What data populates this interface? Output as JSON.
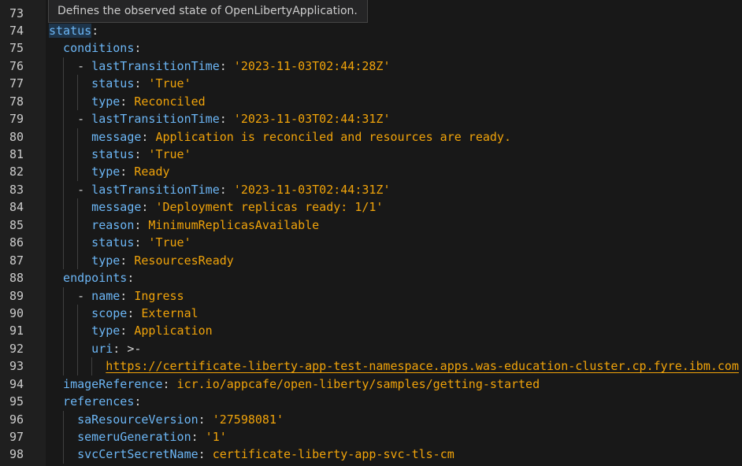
{
  "tooltip": {
    "text": "Defines the observed state of OpenLibertyApplication."
  },
  "colors": {
    "key": "#6cb6f5",
    "value": "#f0a30a",
    "background": "#181818"
  },
  "lines": [
    {
      "n": "73",
      "indent": 0,
      "tokens": []
    },
    {
      "n": "74",
      "indent": 0,
      "tokens": [
        {
          "t": "status",
          "c": "k hl"
        },
        {
          "t": ":",
          "c": "p"
        }
      ]
    },
    {
      "n": "75",
      "indent": 2,
      "tokens": [
        {
          "t": "conditions",
          "c": "k"
        },
        {
          "t": ":",
          "c": "p"
        }
      ]
    },
    {
      "n": "76",
      "indent": 4,
      "tokens": [
        {
          "t": "- ",
          "c": "p"
        },
        {
          "t": "lastTransitionTime",
          "c": "k"
        },
        {
          "t": ": ",
          "c": "p"
        },
        {
          "t": "'2023-11-03T02:44:28Z'",
          "c": "v"
        }
      ]
    },
    {
      "n": "77",
      "indent": 6,
      "tokens": [
        {
          "t": "status",
          "c": "k"
        },
        {
          "t": ": ",
          "c": "p"
        },
        {
          "t": "'True'",
          "c": "v"
        }
      ]
    },
    {
      "n": "78",
      "indent": 6,
      "tokens": [
        {
          "t": "type",
          "c": "k"
        },
        {
          "t": ": ",
          "c": "p"
        },
        {
          "t": "Reconciled",
          "c": "v"
        }
      ]
    },
    {
      "n": "79",
      "indent": 4,
      "tokens": [
        {
          "t": "- ",
          "c": "p"
        },
        {
          "t": "lastTransitionTime",
          "c": "k"
        },
        {
          "t": ": ",
          "c": "p"
        },
        {
          "t": "'2023-11-03T02:44:31Z'",
          "c": "v"
        }
      ]
    },
    {
      "n": "80",
      "indent": 6,
      "tokens": [
        {
          "t": "message",
          "c": "k"
        },
        {
          "t": ": ",
          "c": "p"
        },
        {
          "t": "Application is reconciled and resources are ready.",
          "c": "v"
        }
      ]
    },
    {
      "n": "81",
      "indent": 6,
      "tokens": [
        {
          "t": "status",
          "c": "k"
        },
        {
          "t": ": ",
          "c": "p"
        },
        {
          "t": "'True'",
          "c": "v"
        }
      ]
    },
    {
      "n": "82",
      "indent": 6,
      "tokens": [
        {
          "t": "type",
          "c": "k"
        },
        {
          "t": ": ",
          "c": "p"
        },
        {
          "t": "Ready",
          "c": "v"
        }
      ]
    },
    {
      "n": "83",
      "indent": 4,
      "tokens": [
        {
          "t": "- ",
          "c": "p"
        },
        {
          "t": "lastTransitionTime",
          "c": "k"
        },
        {
          "t": ": ",
          "c": "p"
        },
        {
          "t": "'2023-11-03T02:44:31Z'",
          "c": "v"
        }
      ]
    },
    {
      "n": "84",
      "indent": 6,
      "tokens": [
        {
          "t": "message",
          "c": "k"
        },
        {
          "t": ": ",
          "c": "p"
        },
        {
          "t": "'Deployment replicas ready: 1/1'",
          "c": "v"
        }
      ]
    },
    {
      "n": "85",
      "indent": 6,
      "tokens": [
        {
          "t": "reason",
          "c": "k"
        },
        {
          "t": ": ",
          "c": "p"
        },
        {
          "t": "MinimumReplicasAvailable",
          "c": "v"
        }
      ]
    },
    {
      "n": "86",
      "indent": 6,
      "tokens": [
        {
          "t": "status",
          "c": "k"
        },
        {
          "t": ": ",
          "c": "p"
        },
        {
          "t": "'True'",
          "c": "v"
        }
      ]
    },
    {
      "n": "87",
      "indent": 6,
      "tokens": [
        {
          "t": "type",
          "c": "k"
        },
        {
          "t": ": ",
          "c": "p"
        },
        {
          "t": "ResourcesReady",
          "c": "v"
        }
      ]
    },
    {
      "n": "88",
      "indent": 2,
      "tokens": [
        {
          "t": "endpoints",
          "c": "k"
        },
        {
          "t": ":",
          "c": "p"
        }
      ]
    },
    {
      "n": "89",
      "indent": 4,
      "tokens": [
        {
          "t": "- ",
          "c": "p"
        },
        {
          "t": "name",
          "c": "k"
        },
        {
          "t": ": ",
          "c": "p"
        },
        {
          "t": "Ingress",
          "c": "v"
        }
      ]
    },
    {
      "n": "90",
      "indent": 6,
      "tokens": [
        {
          "t": "scope",
          "c": "k"
        },
        {
          "t": ": ",
          "c": "p"
        },
        {
          "t": "External",
          "c": "v"
        }
      ]
    },
    {
      "n": "91",
      "indent": 6,
      "tokens": [
        {
          "t": "type",
          "c": "k"
        },
        {
          "t": ": ",
          "c": "p"
        },
        {
          "t": "Application",
          "c": "v"
        }
      ]
    },
    {
      "n": "92",
      "indent": 6,
      "tokens": [
        {
          "t": "uri",
          "c": "k"
        },
        {
          "t": ": >-",
          "c": "p"
        }
      ]
    },
    {
      "n": "93",
      "indent": 8,
      "tokens": [
        {
          "t": "https://certificate-liberty-app-test-namespace.apps.was-education-cluster.cp.fyre.ibm.com",
          "c": "u",
          "link": true
        }
      ]
    },
    {
      "n": "94",
      "indent": 2,
      "tokens": [
        {
          "t": "imageReference",
          "c": "k"
        },
        {
          "t": ": ",
          "c": "p"
        },
        {
          "t": "icr.io/appcafe/open-liberty/samples/getting-started",
          "c": "v"
        }
      ]
    },
    {
      "n": "95",
      "indent": 2,
      "tokens": [
        {
          "t": "references",
          "c": "k"
        },
        {
          "t": ":",
          "c": "p"
        }
      ]
    },
    {
      "n": "96",
      "indent": 4,
      "tokens": [
        {
          "t": "saResourceVersion",
          "c": "k"
        },
        {
          "t": ": ",
          "c": "p"
        },
        {
          "t": "'27598081'",
          "c": "v"
        }
      ]
    },
    {
      "n": "97",
      "indent": 4,
      "tokens": [
        {
          "t": "semeruGeneration",
          "c": "k"
        },
        {
          "t": ": ",
          "c": "p"
        },
        {
          "t": "'1'",
          "c": "v"
        }
      ]
    },
    {
      "n": "98",
      "indent": 4,
      "tokens": [
        {
          "t": "svcCertSecretName",
          "c": "k"
        },
        {
          "t": ": ",
          "c": "p"
        },
        {
          "t": "certificate-liberty-app-svc-tls-cm",
          "c": "v"
        }
      ]
    }
  ]
}
